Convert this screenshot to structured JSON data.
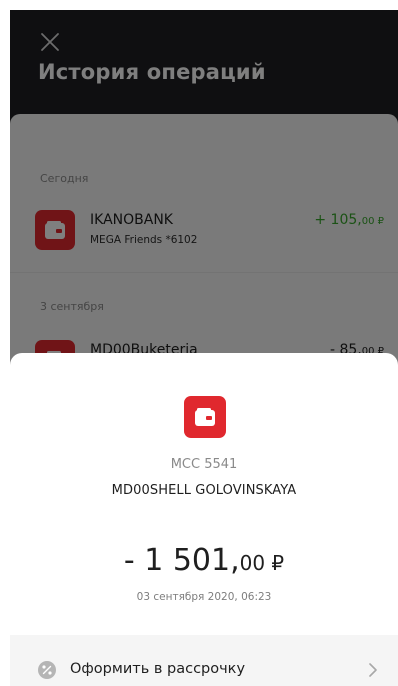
{
  "header": {
    "title": "История операций"
  },
  "history": {
    "sections": [
      {
        "label": "Сегодня",
        "transactions": [
          {
            "name": "IKANOBANK",
            "subtitle": "MEGA Friends *6102",
            "amount_main": "+ 105,",
            "amount_kop": "00 ₽",
            "direction": "income",
            "icon": "wallet-icon"
          }
        ]
      },
      {
        "label": "3 сентября",
        "transactions": [
          {
            "name": "MD00Buketeria",
            "subtitle": "",
            "amount_main": "- 85,",
            "amount_kop": "00 ₽",
            "direction": "expense",
            "icon": "wallet-icon"
          }
        ]
      }
    ]
  },
  "detail": {
    "icon": "wallet-icon",
    "mcc": "MCC 5541",
    "merchant": "MD00SHELL GOLOVINSKAYA",
    "amount_main": "- 1 501,",
    "amount_kop": "00",
    "currency": " ₽",
    "datetime": "03 сентября 2020, 06:23",
    "action": {
      "label": "Оформить в рассрочку",
      "icon": "percent-icon"
    }
  },
  "colors": {
    "accent_red": "#e0282e",
    "income_green": "#37a52b",
    "dark_bg": "#1f1f22"
  }
}
